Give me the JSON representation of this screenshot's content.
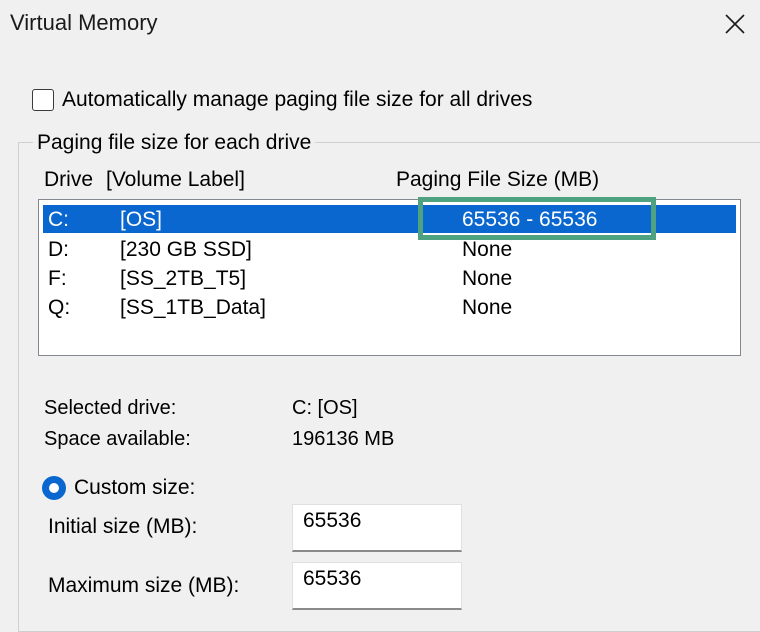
{
  "window": {
    "title": "Virtual Memory"
  },
  "auto_manage": {
    "label": "Automatically manage paging file size for all drives",
    "checked": false
  },
  "group": {
    "label": "Paging file size for each drive"
  },
  "columns": {
    "drive": "Drive",
    "volume_label": "[Volume Label]",
    "paging_size": "Paging File Size (MB)"
  },
  "drives": [
    {
      "drive": "C:",
      "label": "[OS]",
      "size": "65536 - 65536",
      "selected": true
    },
    {
      "drive": "D:",
      "label": "[230 GB SSD]",
      "size": "None",
      "selected": false
    },
    {
      "drive": "F:",
      "label": "[SS_2TB_T5]",
      "size": "None",
      "selected": false
    },
    {
      "drive": "Q:",
      "label": "[SS_1TB_Data]",
      "size": "None",
      "selected": false
    }
  ],
  "selected_info": {
    "selected_drive_label": "Selected drive:",
    "selected_drive_value": "C:  [OS]",
    "space_available_label": "Space available:",
    "space_available_value": "196136 MB"
  },
  "custom_size": {
    "label": "Custom size:",
    "selected": true,
    "initial_label": "Initial size (MB):",
    "initial_value": "65536",
    "maximum_label": "Maximum size (MB):",
    "maximum_value": "65536"
  },
  "colors": {
    "selection": "#0a67d0",
    "highlight_border": "#4ea27f",
    "background": "#f0f0f0"
  },
  "icons": {
    "close": "close-icon",
    "checkbox": "checkbox-icon",
    "radio": "radio-selected-icon"
  }
}
